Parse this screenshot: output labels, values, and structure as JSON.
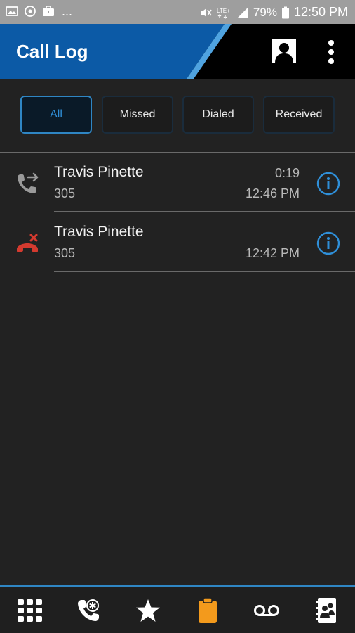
{
  "status_bar": {
    "battery": "79%",
    "time": "12:50 PM",
    "overflow": "...",
    "icons": [
      "gallery-icon",
      "sync-icon",
      "briefcase-icon",
      "mute-vibrate-icon",
      "lte-icon",
      "signal-icon",
      "battery-icon"
    ]
  },
  "app_bar": {
    "title": "Call Log",
    "contact_icon": "contact-card-icon",
    "menu_icon": "more-vertical-icon",
    "colors": {
      "brand_blue": "#0c5aa6",
      "accent_stripe": "#4fa3e0",
      "bar_black": "#000000"
    }
  },
  "filters": {
    "selected": "All",
    "items": [
      {
        "label": "All"
      },
      {
        "label": "Missed"
      },
      {
        "label": "Dialed"
      },
      {
        "label": "Received"
      }
    ]
  },
  "calls": [
    {
      "type": "outgoing",
      "icon": "outgoing-call-icon",
      "name": "Travis Pinette",
      "number": "305",
      "duration": "0:19",
      "time": "12:46 PM"
    },
    {
      "type": "missed",
      "icon": "missed-call-icon",
      "name": "Travis Pinette",
      "number": "305",
      "duration": "",
      "time": "12:42 PM"
    }
  ],
  "bottom_nav": {
    "selected": "call-log",
    "items": [
      {
        "id": "dialpad",
        "icon": "dialpad-icon"
      },
      {
        "id": "voicemail-dial",
        "icon": "star-phone-icon"
      },
      {
        "id": "favorites",
        "icon": "star-icon"
      },
      {
        "id": "call-log",
        "icon": "clipboard-icon"
      },
      {
        "id": "voicemail",
        "icon": "voicemail-icon"
      },
      {
        "id": "contacts",
        "icon": "contacts-book-icon"
      }
    ],
    "colors": {
      "active": "#f39a1c",
      "inactive": "#ffffff",
      "accent_line": "#2f86c4"
    }
  }
}
